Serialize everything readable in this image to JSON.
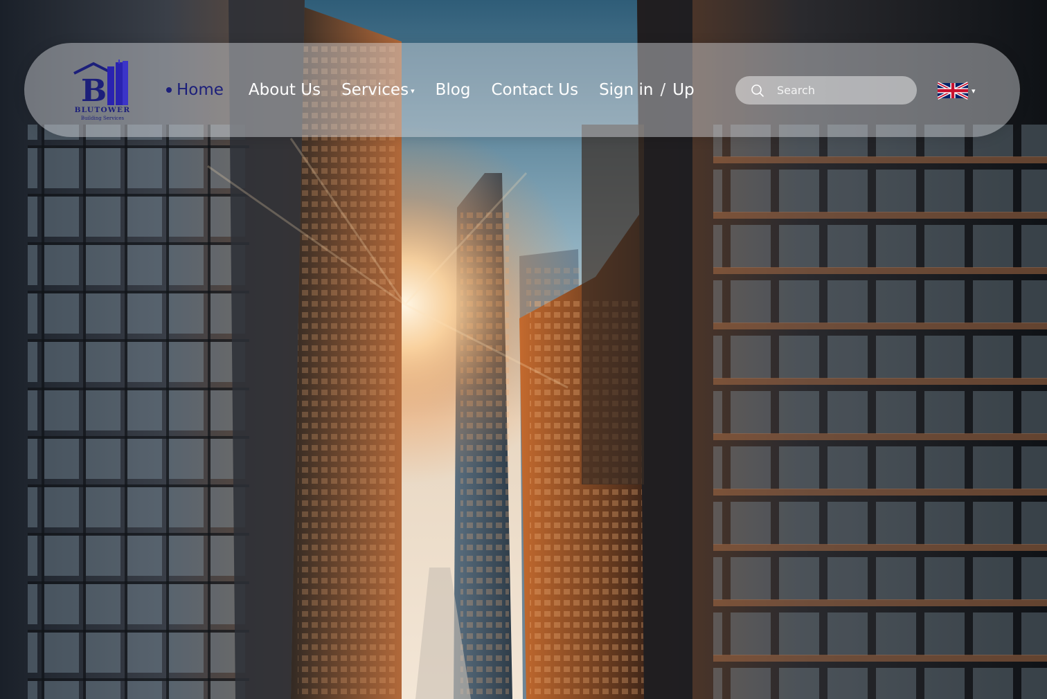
{
  "brand": {
    "name": "BLUTOWER",
    "tagline": "Building Services",
    "logo_icon": "building-b-logo",
    "color": "#1c1f7a"
  },
  "nav": {
    "items": [
      {
        "label": "Home",
        "active": true
      },
      {
        "label": "About Us"
      },
      {
        "label": "Services",
        "has_dropdown": true,
        "dropdown_icon": "caret-down-icon"
      },
      {
        "label": "Blog"
      },
      {
        "label": "Contact Us"
      }
    ],
    "auth": {
      "sign_in": "Sign in",
      "separator": "/",
      "sign_up": "Up"
    },
    "active_color": "#1c1f7a"
  },
  "search": {
    "placeholder": "Search",
    "value": "",
    "icon": "search-icon"
  },
  "language": {
    "flag_icon": "uk-flag-icon",
    "dropdown_icon": "caret-down-icon"
  },
  "hero": {
    "image": "city-skyscrapers-sunrise"
  }
}
